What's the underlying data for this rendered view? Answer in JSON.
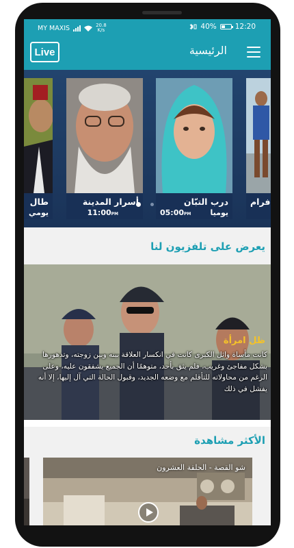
{
  "status_bar": {
    "carrier": "MY MAXIS",
    "net_speed": "20.8",
    "net_speed_unit": "K/s",
    "battery": "40%",
    "battery_level": 0.4,
    "time": "12:20"
  },
  "app_bar": {
    "live_label": "Live",
    "title": "الرئيسية"
  },
  "carousel": {
    "cards": [
      {
        "title": "فرام",
        "time": "",
        "day": ""
      },
      {
        "title": "درب التبّان",
        "time": "05:00",
        "ampm": "PM",
        "day": "يوميا"
      },
      {
        "title": "أسرار المدينة",
        "time": "11:00",
        "ampm": "PM",
        "day": ""
      },
      {
        "title": "طال",
        "time": "",
        "day": "يومي"
      }
    ],
    "active_index": 0
  },
  "sections": {
    "now_showing": "يعرض على تلفزيون لنا",
    "most_watched": "الأكثر مشاهدة"
  },
  "featured": {
    "title": "ظل امرأة",
    "description": "كانت مأساة وائل الكبرى كانت في انكسار العلاقة بينه وبين زوجته، وتدهورها بشكل مفاجئ وغريب، فلم يثق بأحد، متوهمًا أن الجميع يشفقون عليه، وعلى الرغم من محاولاته للتأقلم مع وضعه الجديد، وقبول الحالة التي آل إليها، إلا أنه يفشل في ذلك"
  },
  "most_watched": [
    {
      "title": "شو القصة - الحلقة العشرون"
    }
  ],
  "colors": {
    "accent": "#1d9fb3",
    "carousel_bg": "#1e3b63",
    "featured_title": "#f4c22a"
  }
}
